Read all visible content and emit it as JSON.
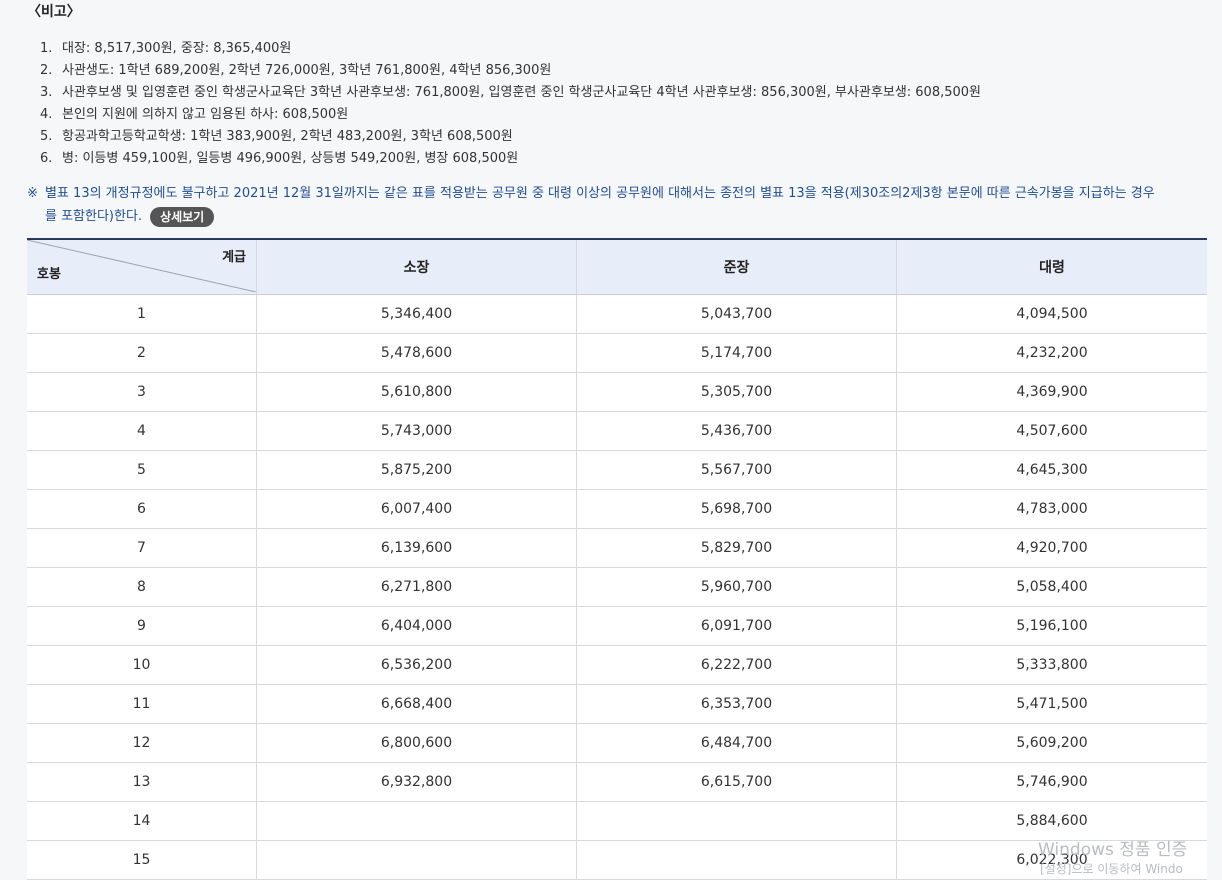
{
  "notes": {
    "title": "〈비고〉",
    "items": [
      {
        "num": "1.",
        "text": "대장: 8,517,300원, 중장: 8,365,400원"
      },
      {
        "num": "2.",
        "text": "사관생도: 1학년 689,200원, 2학년 726,000원, 3학년 761,800원, 4학년 856,300원"
      },
      {
        "num": "3.",
        "text": "사관후보생 및 입영훈련 중인 학생군사교육단 3학년 사관후보생: 761,800원, 입영훈련 중인 학생군사교육단 4학년 사관후보생: 856,300원, 부사관후보생: 608,500원"
      },
      {
        "num": "4.",
        "text": "본인의 지원에 의하지 않고 임용된 하사: 608,500원"
      },
      {
        "num": "5.",
        "text": "항공과학고등학교학생: 1학년 383,900원, 2학년 483,200원, 3학년 608,500원"
      },
      {
        "num": "6.",
        "text": "병: 이등병 459,100원, 일등병 496,900원, 상등병 549,200원, 병장 608,500원"
      }
    ]
  },
  "remark": {
    "mark": "※",
    "line1": "별표 13의 개정규정에도 불구하고 2021년 12월 31일까지는 같은 표를 적용받는 공무원 중 대령 이상의 공무원에 대해서는 종전의 별표 13을 적용(제30조의2제3항 본문에 따른 근속가봉을 지급하는 경우",
    "line2": "를 포함한다)한다.",
    "button": "상세보기"
  },
  "table": {
    "corner_top": "계급",
    "corner_bottom": "호봉",
    "columns": [
      "소장",
      "준장",
      "대령"
    ],
    "rows": [
      [
        "1",
        "5,346,400",
        "5,043,700",
        "4,094,500"
      ],
      [
        "2",
        "5,478,600",
        "5,174,700",
        "4,232,200"
      ],
      [
        "3",
        "5,610,800",
        "5,305,700",
        "4,369,900"
      ],
      [
        "4",
        "5,743,000",
        "5,436,700",
        "4,507,600"
      ],
      [
        "5",
        "5,875,200",
        "5,567,700",
        "4,645,300"
      ],
      [
        "6",
        "6,007,400",
        "5,698,700",
        "4,783,000"
      ],
      [
        "7",
        "6,139,600",
        "5,829,700",
        "4,920,700"
      ],
      [
        "8",
        "6,271,800",
        "5,960,700",
        "5,058,400"
      ],
      [
        "9",
        "6,404,000",
        "6,091,700",
        "5,196,100"
      ],
      [
        "10",
        "6,536,200",
        "6,222,700",
        "5,333,800"
      ],
      [
        "11",
        "6,668,400",
        "6,353,700",
        "5,471,500"
      ],
      [
        "12",
        "6,800,600",
        "6,484,700",
        "5,609,200"
      ],
      [
        "13",
        "6,932,800",
        "6,615,700",
        "5,746,900"
      ],
      [
        "14",
        "",
        "",
        "5,884,600"
      ],
      [
        "15",
        "",
        "",
        "6,022,300"
      ]
    ]
  },
  "watermark": {
    "line1": "Windows 정품 인증",
    "line2": "[설정]으로 이동하여 Windo"
  }
}
